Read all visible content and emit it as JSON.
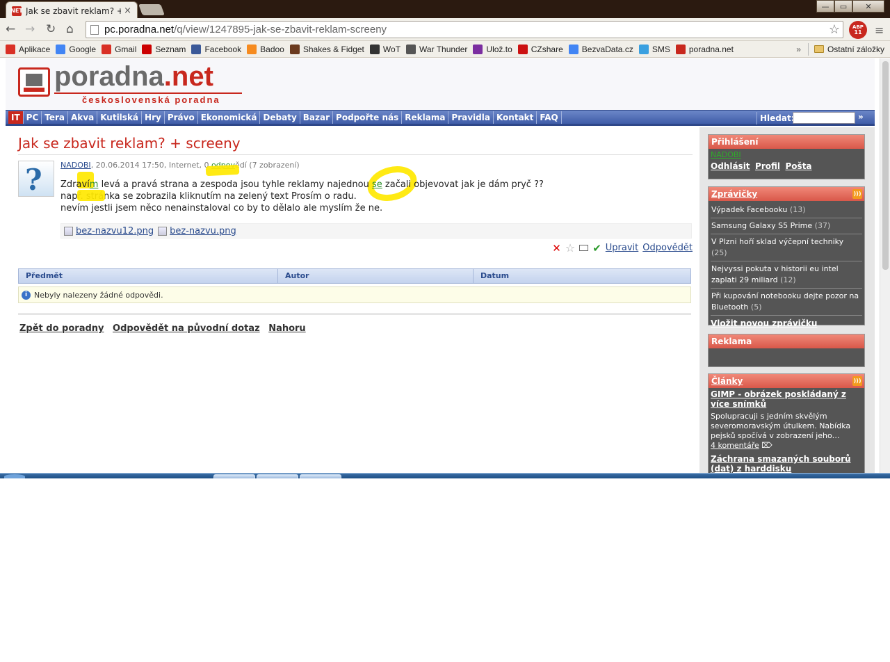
{
  "browser": {
    "tab_title": "Jak se zbavit reklam? + scr",
    "tab_close": "×",
    "tab_favicon": "NET",
    "url_host": "pc.poradna.net",
    "url_path": "/q/view/1247895-jak-se-zbavit-reklam-screeny",
    "extension_badge": "ABP",
    "extension_count": "11",
    "window_buttons": {
      "minimize": "—",
      "maximize": "▭",
      "close": "✕"
    },
    "nav_icons": [
      "back-arrow-icon",
      "forward-arrow-icon",
      "reload-icon",
      "home-icon"
    ],
    "bookmarks": [
      {
        "label": "Aplikace",
        "icon": "apps-grid-icon",
        "color": "#d93025"
      },
      {
        "label": "Google",
        "icon": "google-icon",
        "color": "#4285f4"
      },
      {
        "label": "Gmail",
        "icon": "gmail-icon",
        "color": "#d93025"
      },
      {
        "label": "Seznam",
        "icon": "seznam-icon",
        "color": "#cc0000"
      },
      {
        "label": "Facebook",
        "icon": "facebook-icon",
        "color": "#3b5998"
      },
      {
        "label": "Badoo",
        "icon": "badoo-icon",
        "color": "#f68b1f"
      },
      {
        "label": "Shakes & Fidget",
        "icon": "shakes-fidget-icon",
        "color": "#6b3a1e"
      },
      {
        "label": "WoT",
        "icon": "wot-icon",
        "color": "#333333"
      },
      {
        "label": "War Thunder",
        "icon": "war-thunder-icon",
        "color": "#555555"
      },
      {
        "label": "Ulož.to",
        "icon": "ulozto-icon",
        "color": "#7b2ea0"
      },
      {
        "label": "CZshare",
        "icon": "czshare-icon",
        "color": "#cc1111"
      },
      {
        "label": "BezvaData.cz",
        "icon": "google-icon",
        "color": "#4285f4"
      },
      {
        "label": "SMS",
        "icon": "sms-icon",
        "color": "#3aa0e0"
      },
      {
        "label": "poradna.net",
        "icon": "poradna-icon",
        "color": "#c8281e"
      }
    ],
    "bookmarks_more": "»",
    "other_bookmarks": "Ostatní záložky"
  },
  "site": {
    "logo_main": "poradna",
    "logo_tld": ".net",
    "logo_sub": "československá poradna",
    "nav": [
      "IT",
      "PC",
      "Tera",
      "Akva",
      "Kutilská",
      "Hry",
      "Právo",
      "Ekonomická",
      "Debaty",
      "Bazar",
      "Podpořte nás",
      "Reklama",
      "Pravidla",
      "Kontakt",
      "FAQ"
    ],
    "search_label": "Hledat:",
    "search_go": "»"
  },
  "question": {
    "title": "Jak se zbavit reklam? + screeny",
    "author": "NADOBI",
    "meta_mid": ", 20.06.2014 17:50, Internet, 0 ",
    "answers_link": "odpov",
    "meta_end": "ědí (7 zobrazení)",
    "line1_a": "Zdraví",
    "line1_link": "m",
    "line1_b": " levá a pravá strana a zespoda jsou tyhle reklamy najednou ",
    "line1_link2": "se",
    "line1_c": " začali objevovat jak je dám pryč ??",
    "line2": "např. stránka se zobrazila kliknutím na zelený text Prosím o radu.",
    "line3": "nevím jestli jsem něco nenainstaloval co by to dělalo ale myslím že ne.",
    "attachments": [
      "bez-nazvu12.png",
      "bez-nazvu.png"
    ],
    "action_edit": "Upravit",
    "action_reply": "Odpovědět"
  },
  "answers_table": {
    "headers": [
      "Předmět",
      "Autor",
      "Datum"
    ],
    "empty_message": "Nebyly nalezeny žádné odpovědi."
  },
  "bottom_links": [
    "Zpět do poradny",
    "Odpovědět na původní dotaz",
    "Nahoru"
  ],
  "sidebar": {
    "login": {
      "title": "Přihlášení",
      "user": "NADOBI",
      "links": [
        "Odhlásit",
        "Profil",
        "Pošta"
      ]
    },
    "news": {
      "title": "Zprávičky",
      "items": [
        {
          "text": "Výpadek Facebooku",
          "count": "(13)"
        },
        {
          "text": "Samsung Galaxy S5 Prime",
          "count": "(37)"
        },
        {
          "text": "V Plzni hoří sklad výčepní techniky",
          "count": "(25)"
        },
        {
          "text": "Nejvyssi pokuta v historii eu intel zaplati 29 miliard",
          "count": "(12)"
        },
        {
          "text": "Při kupování notebooku dejte pozor na Bluetooth",
          "count": "(5)"
        }
      ],
      "add": "Vložit novou zprávičku"
    },
    "ads": {
      "title": "Reklama"
    },
    "articles": {
      "title": "Články",
      "items": [
        {
          "title": "GIMP - obrázek poskládaný z více snímků",
          "text": "Spolupracuji s jedním skvělým severomoravským útulkem. Nabídka pejsků spočívá v zobrazení jeho…",
          "comments": "4 komentáře"
        },
        {
          "title": "Záchrana smazaných souborů (dat) z harddisku",
          "text": "",
          "comments": ""
        }
      ]
    }
  },
  "colors": {
    "brand_red": "#c8281e",
    "nav_blue": "#3f5ca8",
    "highlight_yellow": "#ffe800"
  }
}
